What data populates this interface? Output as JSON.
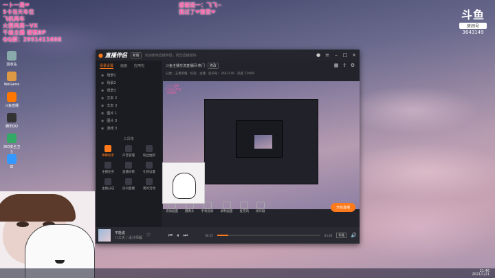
{
  "overlay": {
    "lines": [
      "一卜一局❤",
      "5卡当天车位",
      "飞机两车",
      "火箭两周~VX",
      "千级主播 谨慎BP",
      "QQ群：2951411608"
    ],
    "top_center": [
      "感谢送一：飞飞~",
      "我过了❤窗里❤"
    ]
  },
  "douyu": {
    "logo": "斗鱼",
    "tag": "房间号",
    "room_id": "3643149"
  },
  "desktop_icons": [
    {
      "label": "回收站",
      "color": "#8aa"
    },
    {
      "label": "WeGame",
      "color": "#d94"
    },
    {
      "label": "斗鱼直播",
      "color": "#f70"
    },
    {
      "label": "腾讯QQ",
      "color": "#333"
    },
    {
      "label": "360安全卫士",
      "color": "#3a6"
    },
    {
      "label": "IE",
      "color": "#39f"
    }
  ],
  "app": {
    "brand": "直播伴侣",
    "version": "新版",
    "title_msg": "欢迎使用直播伴侣，祝您直播愉快",
    "tabs": [
      "场景设置",
      "画面",
      "应用包"
    ],
    "scenes": [
      "场景1",
      "场景2",
      "场景3",
      "文本 2",
      "文本 3",
      "图片 1",
      "图片 3",
      "游戏 3"
    ],
    "tools_title": "工具箱",
    "tools": [
      {
        "label": "弹幕助手",
        "active": true
      },
      {
        "label": "声音管理",
        "active": false
      },
      {
        "label": "粉丝抽奖",
        "active": false
      },
      {
        "label": "主播任务",
        "active": false
      },
      {
        "label": "直播间管",
        "active": false
      },
      {
        "label": "礼物设置",
        "active": false
      },
      {
        "label": "主播分成",
        "active": false
      },
      {
        "label": "房间直播",
        "active": false
      },
      {
        "label": "我的活动",
        "active": false
      }
    ],
    "room_title": "斗鱼主播交流直播间-热门",
    "room_btn": "修改",
    "sub_info": [
      "分类：王者荣耀",
      "标签：主播",
      "房间号：3643149",
      "热度 12969"
    ],
    "controls": [
      "添加画面",
      "摄像头",
      "手机投屏",
      "录制画面",
      "麦克风",
      "扬声器"
    ],
    "start_label": "开始直播",
    "status": {
      "msg": "欢迎使用直播伴侣，如遇到问题请联系客服",
      "rec_time": "00:00:00",
      "live_time": "00:00:00"
    }
  },
  "music": {
    "title": "不能说",
    "artist": "八三夭 / 设计师版",
    "time_cur": "00:25",
    "time_total": "03:46",
    "progress": 0.11,
    "quality": "标准"
  },
  "tray": {
    "time": "21:46",
    "date": "2021/1/21"
  }
}
